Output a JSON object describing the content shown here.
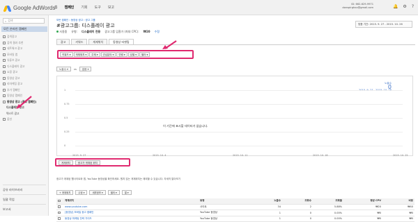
{
  "app": {
    "name": "Google AdWords"
  },
  "nav": [
    "홈",
    "캠페인",
    "기회",
    "도구",
    "보고"
  ],
  "account": {
    "id": "ID: 662-629-9971",
    "email": "donspirghov@gmail.com"
  },
  "sidebar": {
    "search_placeholder": "검색",
    "all_campaigns": "모든 온라인 캠페인",
    "items": [
      "검색광고",
      "검색 결과 추천",
      "네트워크 광고",
      "모바일 앱",
      "유튜브 광고",
      "디스플레이 광고",
      "쇼핑 광고",
      "동영상 광고",
      "리마케팅 광고",
      "추가 캠페인",
      "동영상 캠페인"
    ],
    "active_item": "동영상 광고 (광고 캠페인)",
    "sub_items": [
      "디스플레이 광고",
      "텍스트 광고"
    ],
    "last_item": "옵션",
    "bottom": [
      "공유 라이브러리",
      "일괄 작업",
      "보고서"
    ]
  },
  "main": {
    "breadcrumb": "모든 캠페인 › 동영상 광고 › 광고 그룹",
    "title": "#광고그룹: 디스플레이 광고",
    "date_range": "맞춤 기간: 2015. 9. 27 - 2015. 10. 26",
    "status": {
      "label": "사용중",
      "type_label": "유형:",
      "type_value": "디스플레이 전용",
      "bid_label": "광고그룹 입찰가 (최대 CPC):",
      "bid_value": "₩20",
      "edit": "수정"
    },
    "tabs": [
      "광고",
      "키워드",
      "게재위치",
      "동영상 타겟팅"
    ],
    "active_tab": "동영상 타겟팅",
    "filters": [
      "키워드 ▾",
      "게재위치 ▾",
      "주제 ▾",
      "관심분야 ▾",
      "연령 ▾",
      "성별 ▾",
      "필터 ▾"
    ],
    "metrics": {
      "m1": "노출수 ▾",
      "vs": "vs",
      "m2": "없음 ▾"
    },
    "views": [
      "게재위치",
      "광고가 게재된 위치"
    ],
    "info": "광고가 게재된 웹사이트와 앱, YouTube 동영상을 확인하세요. 원치 않는 게재위치는 제외할 수 있습니다. 자세히 알아보기",
    "table_tools": [
      "+ 게재위치",
      "수정 ▾",
      "세부정보 ▾",
      "필터 ▾",
      "열 ▾"
    ]
  },
  "chart_data": {
    "type": "line",
    "x_ticks": [
      "2015. 9. 27",
      "2015. 10. 4",
      "2015. 10. 11",
      "2015. 10. 18",
      "2015. 10. 25"
    ],
    "y_ticks": [
      "0",
      "0.25",
      "0.5",
      "0.75",
      "1"
    ],
    "legend": "노출수",
    "legend_value": "0",
    "legend_range": "2015. 9. 27 - 2015. 10. 26",
    "no_data": "이 기간에 표시할 데이터가 없습니다.",
    "series": []
  },
  "table": {
    "headers": [
      "",
      "게재위치",
      "유형",
      "노출수",
      "조회수",
      "조회율",
      "평균 CPV",
      "비용"
    ],
    "rows": [
      [
        "www.youtube.com",
        "사이트",
        "34",
        "2",
        "5.88%",
        "₩20",
        "₩40"
      ],
      [
        "[동영상] 모바일 광고 캠페인",
        "YouTube 동영상",
        "1",
        "0",
        "0.00%",
        "₩0",
        "₩0"
      ],
      [
        "동영상 마케팅 전략 가이드",
        "YouTube 동영상",
        "1",
        "0",
        "0.00%",
        "₩0",
        "₩0"
      ]
    ]
  },
  "colors": {
    "highlight": "#e0296f",
    "link": "#1a66c7",
    "accent": "#3a6fc7"
  }
}
